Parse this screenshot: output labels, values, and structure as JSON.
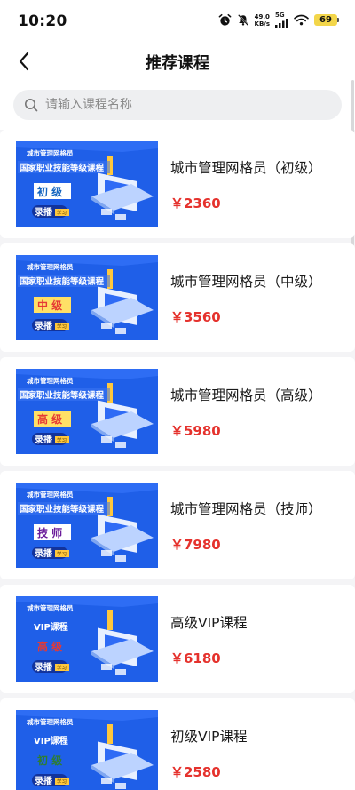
{
  "status_bar": {
    "time": "10:20",
    "net_speed_value": "49.0",
    "net_speed_unit": "KB/s",
    "network": "5G",
    "battery": "69",
    "icons": [
      "alarm-icon",
      "mute-bell-icon",
      "signal-icon",
      "wifi-icon",
      "battery-icon"
    ]
  },
  "header": {
    "title": "推荐课程",
    "back_icon": "chevron-left-icon"
  },
  "search": {
    "placeholder": "请输入课程名称",
    "icon": "search-icon"
  },
  "courses": [
    {
      "name": "城市管理网格员（初级）",
      "price": "￥2360",
      "banner": {
        "top_label": "城市管理网格员",
        "subtitle": "国家职业技能等级课程",
        "level": "初 级",
        "level_color": "#1565c0",
        "level_bg": "#ffffff",
        "badge": "录播",
        "badge_tag": "学习"
      }
    },
    {
      "name": "城市管理网格员（中级）",
      "price": "￥3560",
      "banner": {
        "top_label": "城市管理网格员",
        "subtitle": "国家职业技能等级课程",
        "level": "中 级",
        "level_color": "#e53935",
        "level_bg": "#ffe066",
        "badge": "录播",
        "badge_tag": "学习"
      }
    },
    {
      "name": "城市管理网格员（高级）",
      "price": "￥5980",
      "banner": {
        "top_label": "城市管理网格员",
        "subtitle": "国家职业技能等级课程",
        "level": "高 级",
        "level_color": "#e53935",
        "level_bg": "#ffe066",
        "badge": "录播",
        "badge_tag": "学习"
      }
    },
    {
      "name": "城市管理网格员（技师）",
      "price": "￥7980",
      "banner": {
        "top_label": "城市管理网格员",
        "subtitle": "国家职业技能等级课程",
        "level": "技 师",
        "level_color": "#6a1b9a",
        "level_bg": "#ffffff",
        "badge": "录播",
        "badge_tag": "学习"
      }
    },
    {
      "name": "高级VIP课程",
      "price": "￥6180",
      "banner": {
        "top_label": "城市管理网格员",
        "subtitle": "VIP课程",
        "level": "高 级",
        "level_color": "#e53935",
        "level_bg": "transparent",
        "badge": "录播",
        "badge_tag": "学习"
      }
    },
    {
      "name": "初级VIP课程",
      "price": "￥2580",
      "banner": {
        "top_label": "城市管理网格员",
        "subtitle": "VIP课程",
        "level": "初 级",
        "level_color": "#2e7d32",
        "level_bg": "transparent",
        "badge": "录播",
        "badge_tag": "学习"
      }
    }
  ],
  "colors": {
    "price": "#e5322d",
    "banner_blue": "#1e5ce6",
    "page_bg": "#f4f4f6"
  }
}
